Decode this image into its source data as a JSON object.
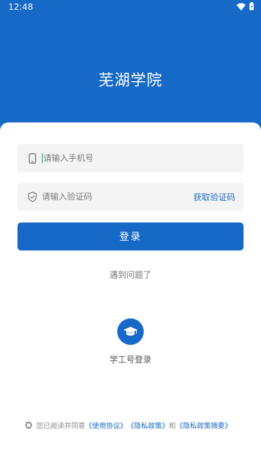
{
  "status_bar": {
    "time": "12:48",
    "icons": [
      "wifi-icon",
      "battery-icon"
    ]
  },
  "header": {
    "title": "芜湖学院"
  },
  "form": {
    "phone_placeholder": "请输入手机号",
    "phone_value": "",
    "code_placeholder": "请输入验证码",
    "code_value": "",
    "get_code_label": "获取验证码",
    "login_label": "登录",
    "problem_label": "遇到问题了"
  },
  "alt_login": {
    "label": "学工号登录",
    "icon": "graduation-cap-icon"
  },
  "agreement": {
    "prefix": "您已阅读并同意",
    "terms_label": "《使用协议》",
    "privacy_label": "《隐私政策》",
    "conjunction": "和",
    "privacy_summary_label": "《隐私政策摘要》"
  },
  "colors": {
    "brand": "#1769c8",
    "link": "#1f6bc0",
    "field_bg": "#f4f4f4"
  }
}
